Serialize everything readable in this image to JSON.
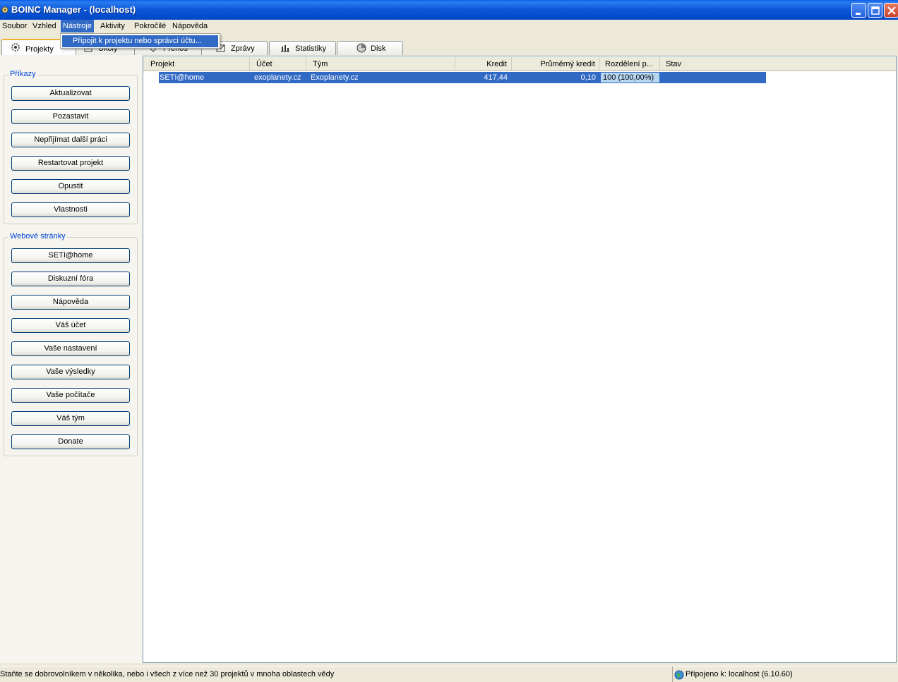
{
  "window": {
    "title": "BOINC Manager - (localhost)"
  },
  "menu": {
    "items": [
      "Soubor",
      "Vzhled",
      "Nástroje",
      "Aktivity",
      "Pokročilé",
      "Nápověda"
    ],
    "active_index": 2,
    "dropdown_item": "Připojit k projektu nebo správci účtu..."
  },
  "tabs": [
    {
      "label": "Projekty",
      "icon": "projects-icon",
      "selected": true
    },
    {
      "label": "Úkoly",
      "icon": "tasks-icon"
    },
    {
      "label": "Přenos",
      "icon": "transfers-icon"
    },
    {
      "label": "Zprávy",
      "icon": "messages-icon"
    },
    {
      "label": "Statistiky",
      "icon": "statistics-icon"
    },
    {
      "label": "Disk",
      "icon": "disk-icon"
    }
  ],
  "commands": {
    "title": "Příkazy",
    "buttons": [
      "Aktualizovat",
      "Pozastavit",
      "Nepřijímat další práci",
      "Restartovat projekt",
      "Opustit",
      "Vlastnosti"
    ]
  },
  "websites": {
    "title": "Webové stránky",
    "buttons": [
      "SETI@home",
      "Diskuzní fóra",
      "Nápověda",
      "Váš účet",
      "Vaše nastavení",
      "Vaše výsledky",
      "Vaše počítače",
      "Váš tým",
      "Donate"
    ]
  },
  "table": {
    "columns": [
      "Projekt",
      "Účet",
      "Tým",
      "Kredit",
      "Průměrný kredit",
      "Rozdělení p...",
      "Stav"
    ],
    "rows": [
      {
        "project": "SETI@home",
        "account": "exoplanety.cz",
        "team": "Exoplanety.cz",
        "credit": "417,44",
        "avg_credit": "0,10",
        "share": "100 (100,00%)",
        "status": ""
      }
    ]
  },
  "status": {
    "left": "Staňte se dobrovolníkem v několika, nebo i všech z více než 30 projektů v mnoha oblastech vědy",
    "right": "Připojeno k: localhost (6.10.60)"
  },
  "colors": {
    "titlebar": "#0b58d8",
    "selection": "#316ac5",
    "group_title": "#0046d5"
  }
}
